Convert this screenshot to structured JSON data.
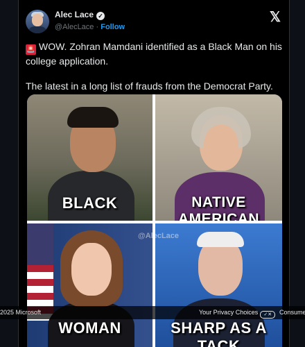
{
  "tweet": {
    "author": "Alec Lace",
    "handle": "@AlecLace",
    "separator": "·",
    "follow": "Follow",
    "text_line1": "WOW. Zohran Mamdani identified as a Black Man on his college application.",
    "text_line2": "The latest in a long list of frauds from the Democrat Party.",
    "x_logo": "𝕏"
  },
  "image": {
    "captions": [
      "BLACK",
      "NATIVE AMERICAN",
      "WOMAN",
      "SHARP AS A TACK"
    ],
    "watermark": "@AlecLace"
  },
  "footer": {
    "copyright": "2025 Microsoft",
    "privacy": "Your Privacy Choices",
    "consumer": "Consume"
  },
  "icons": {
    "siren": "rotating-light-icon",
    "verified": "verified-badge-icon",
    "x": "x-logo-icon",
    "privacy_toggle": "privacy-toggle-icon"
  }
}
